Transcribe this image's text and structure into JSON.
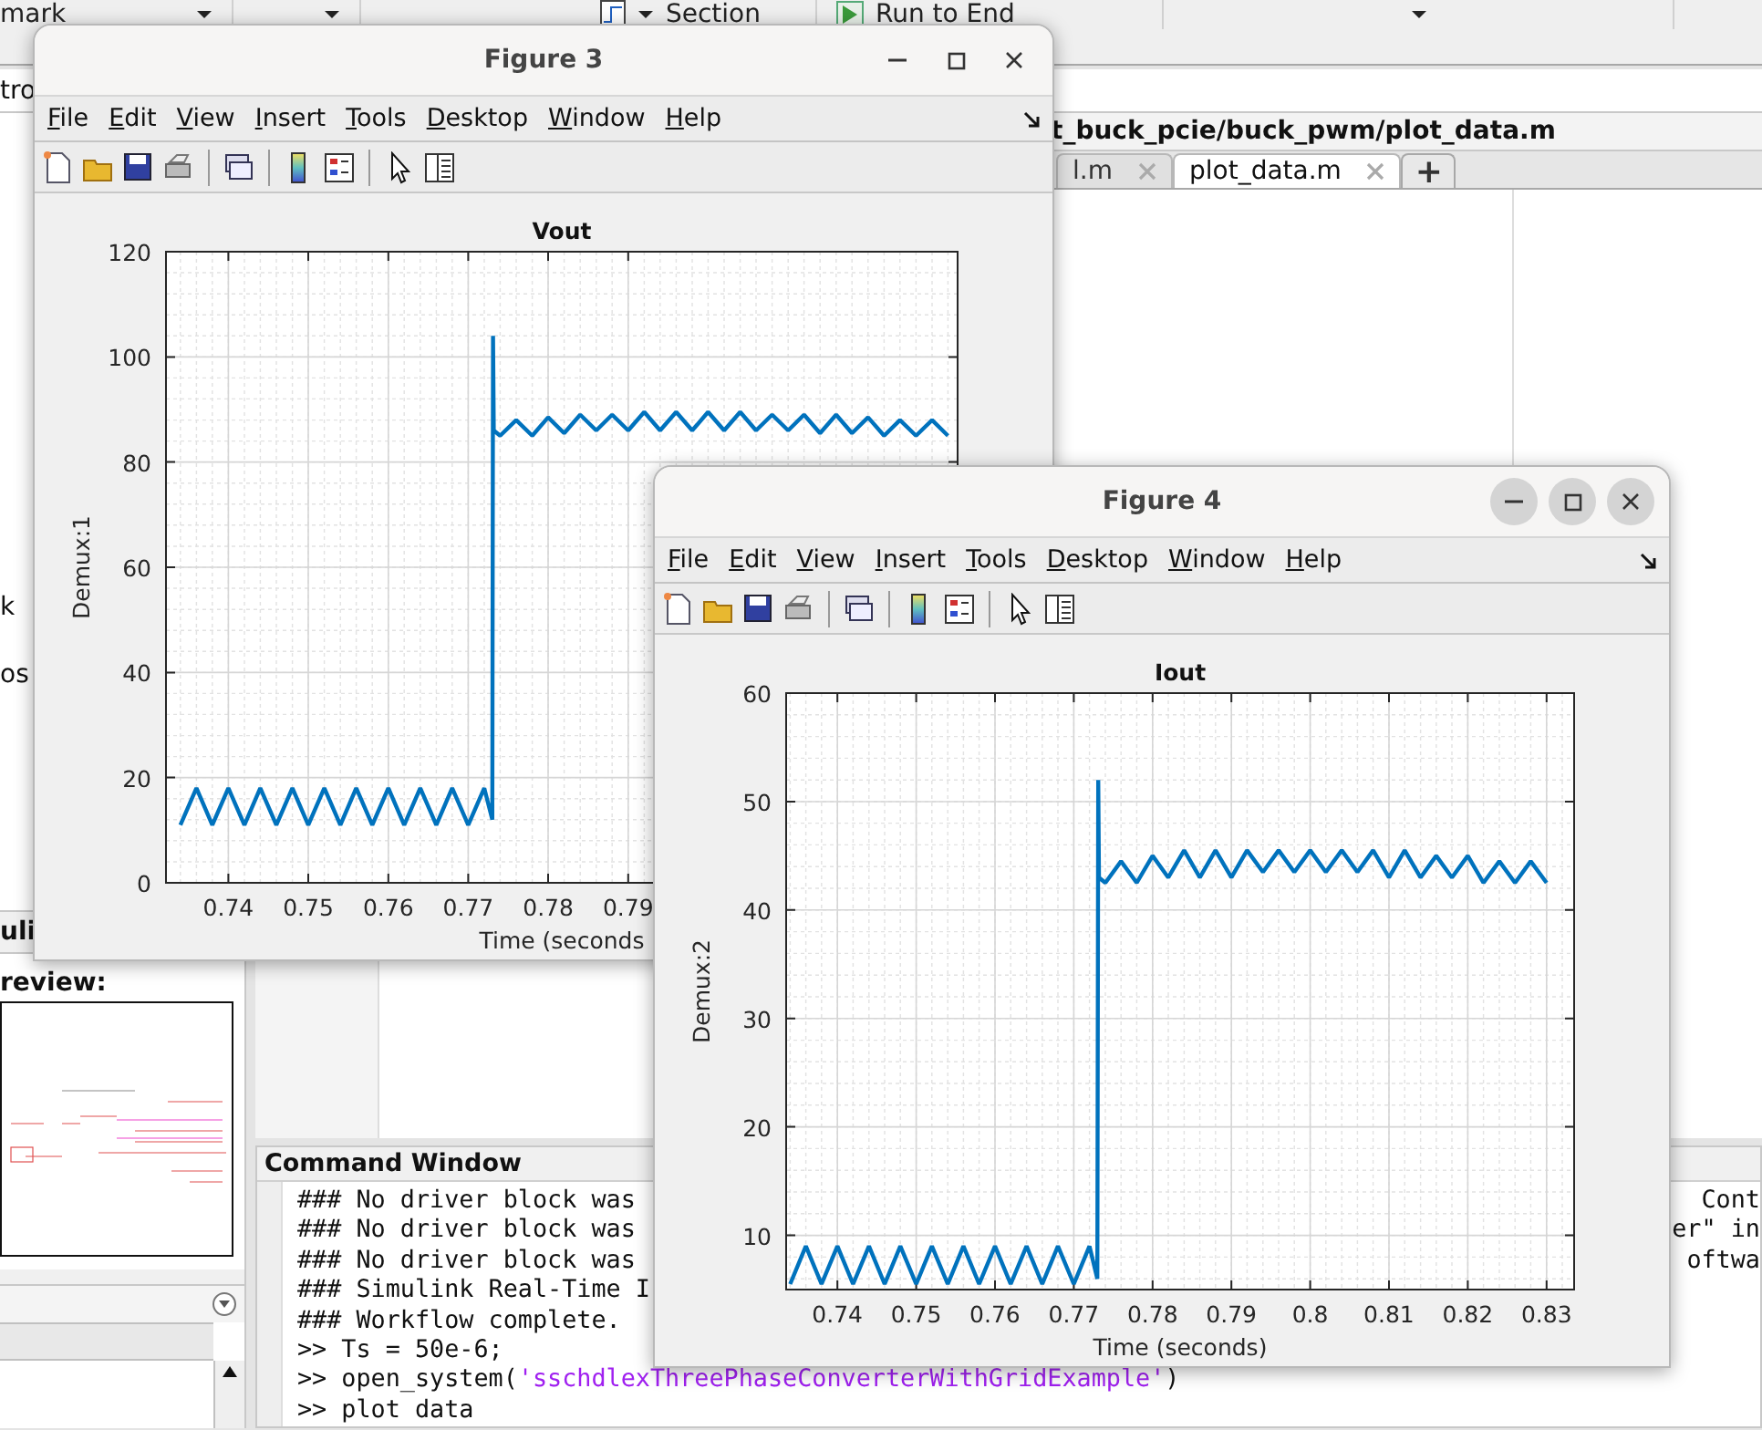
{
  "toolstrip": {
    "items": [
      {
        "kind": "dropdown",
        "label": "mark"
      },
      {
        "kind": "text",
        "label": "Section"
      },
      {
        "kind": "icon-button",
        "label": "Run to End"
      }
    ]
  },
  "address_bar": {
    "value": "tro"
  },
  "file_list": {
    "items": [
      {
        "label": "k"
      },
      {
        "label": "os"
      }
    ]
  },
  "simulink_panel": {
    "title": "uli",
    "preview_label": "review:"
  },
  "editor": {
    "path": "t_buck_pcie/buck_pwm/plot_data.m",
    "tabs": [
      {
        "label": "l.m",
        "selected": false
      },
      {
        "label": "plot_data.m",
        "selected": true
      }
    ],
    "new_tab": "+"
  },
  "command_window": {
    "title": "Command Window",
    "lines": [
      {
        "segments": [
          {
            "kind": "code",
            "text": "### No driver block was"
          }
        ],
        "tail": "Cont"
      },
      {
        "segments": [
          {
            "kind": "code",
            "text": "### No driver block was"
          }
        ],
        "tail": "er\" in"
      },
      {
        "segments": [
          {
            "kind": "code",
            "text": "### No driver block was"
          }
        ],
        "tail": "oftwa"
      },
      {
        "segments": [
          {
            "kind": "code",
            "text": "### Simulink Real-Time I"
          }
        ]
      },
      {
        "segments": [
          {
            "kind": "code",
            "text": "### Workflow complete."
          }
        ]
      },
      {
        "segments": [
          {
            "kind": "code",
            "text": ">> Ts = 50e-6;"
          }
        ]
      },
      {
        "segments": [
          {
            "kind": "code",
            "text": ">> open_system("
          },
          {
            "kind": "string",
            "text": "'sschdlexThreePhaseConverterWithGridExample'"
          },
          {
            "kind": "code",
            "text": ")"
          }
        ]
      },
      {
        "segments": [
          {
            "kind": "code",
            "text": ">> plot data"
          }
        ]
      }
    ]
  },
  "figures": [
    {
      "title": "Figure 3",
      "active": false,
      "menu": [
        "File",
        "Edit",
        "View",
        "Insert",
        "Tools",
        "Desktop",
        "Window",
        "Help"
      ],
      "chart_data": {
        "type": "line",
        "grid": true,
        "title": "Vout",
        "xlabel": "Time (seconds",
        "ylabel": "Demux:1",
        "xlim": [
          0.7322,
          0.8312
        ],
        "ylim": [
          0,
          120
        ],
        "xticks": [
          0.74,
          0.75,
          0.76,
          0.77,
          0.78,
          0.79
        ],
        "yticks": [
          0,
          20,
          40,
          60,
          80,
          100,
          120
        ],
        "x": [
          0.734,
          0.736,
          0.738,
          0.74,
          0.742,
          0.744,
          0.746,
          0.748,
          0.75,
          0.752,
          0.754,
          0.756,
          0.758,
          0.76,
          0.762,
          0.764,
          0.766,
          0.768,
          0.77,
          0.772,
          0.773,
          0.7731,
          0.7732,
          0.774,
          0.776,
          0.778,
          0.78,
          0.782,
          0.784,
          0.786,
          0.788,
          0.79,
          0.792,
          0.794,
          0.796,
          0.798,
          0.8,
          0.802,
          0.804,
          0.806,
          0.808,
          0.81,
          0.812,
          0.814,
          0.816,
          0.818,
          0.82,
          0.822,
          0.824,
          0.826,
          0.828,
          0.83
        ],
        "series": [
          {
            "color": "#0072bd",
            "values": [
              11,
              18,
              11,
              18,
              11,
              18,
              11,
              18,
              11,
              18,
              11,
              18,
              11,
              18,
              11,
              18,
              11,
              18,
              11,
              18,
              12,
              104,
              86,
              85,
              88,
              85,
              88.5,
              85.5,
              89,
              86,
              89,
              86,
              89.5,
              86,
              89.5,
              86,
              89.5,
              86,
              89.5,
              86,
              89,
              86,
              89,
              85.5,
              89,
              85.5,
              88.5,
              85,
              88,
              85,
              88,
              85
            ]
          }
        ]
      }
    },
    {
      "title": "Figure 4",
      "active": true,
      "menu": [
        "File",
        "Edit",
        "View",
        "Insert",
        "Tools",
        "Desktop",
        "Window",
        "Help"
      ],
      "chart_data": {
        "type": "line",
        "grid": true,
        "title": "Iout",
        "xlabel": "Time (seconds)",
        "ylabel": "Demux:2",
        "xlim": [
          0.7335,
          0.8335
        ],
        "ylim": [
          5,
          60
        ],
        "xticks": [
          0.74,
          0.75,
          0.76,
          0.77,
          0.78,
          0.79,
          0.8,
          0.81,
          0.82,
          0.83
        ],
        "yticks": [
          10,
          20,
          30,
          40,
          50,
          60
        ],
        "x": [
          0.734,
          0.736,
          0.738,
          0.74,
          0.742,
          0.744,
          0.746,
          0.748,
          0.75,
          0.752,
          0.754,
          0.756,
          0.758,
          0.76,
          0.762,
          0.764,
          0.766,
          0.768,
          0.77,
          0.772,
          0.773,
          0.7731,
          0.7732,
          0.774,
          0.776,
          0.778,
          0.78,
          0.782,
          0.784,
          0.786,
          0.788,
          0.79,
          0.792,
          0.794,
          0.796,
          0.798,
          0.8,
          0.802,
          0.804,
          0.806,
          0.808,
          0.81,
          0.812,
          0.814,
          0.816,
          0.818,
          0.82,
          0.822,
          0.824,
          0.826,
          0.828,
          0.83
        ],
        "series": [
          {
            "color": "#0072bd",
            "values": [
              5.5,
              9,
              5.5,
              9,
              5.5,
              9,
              5.5,
              9,
              5.5,
              9,
              5.5,
              9,
              5.5,
              9,
              5.5,
              9,
              5.5,
              9,
              5.5,
              9,
              6,
              52,
              43,
              42.5,
              44.5,
              42.5,
              45,
              43,
              45.5,
              43,
              45.5,
              43,
              45.5,
              43.5,
              45.5,
              43.5,
              45.5,
              43.5,
              45.5,
              43.5,
              45.5,
              43,
              45.5,
              43,
              45,
              43,
              45,
              42.5,
              44.5,
              42.5,
              44.5,
              42.5
            ]
          }
        ]
      }
    }
  ]
}
